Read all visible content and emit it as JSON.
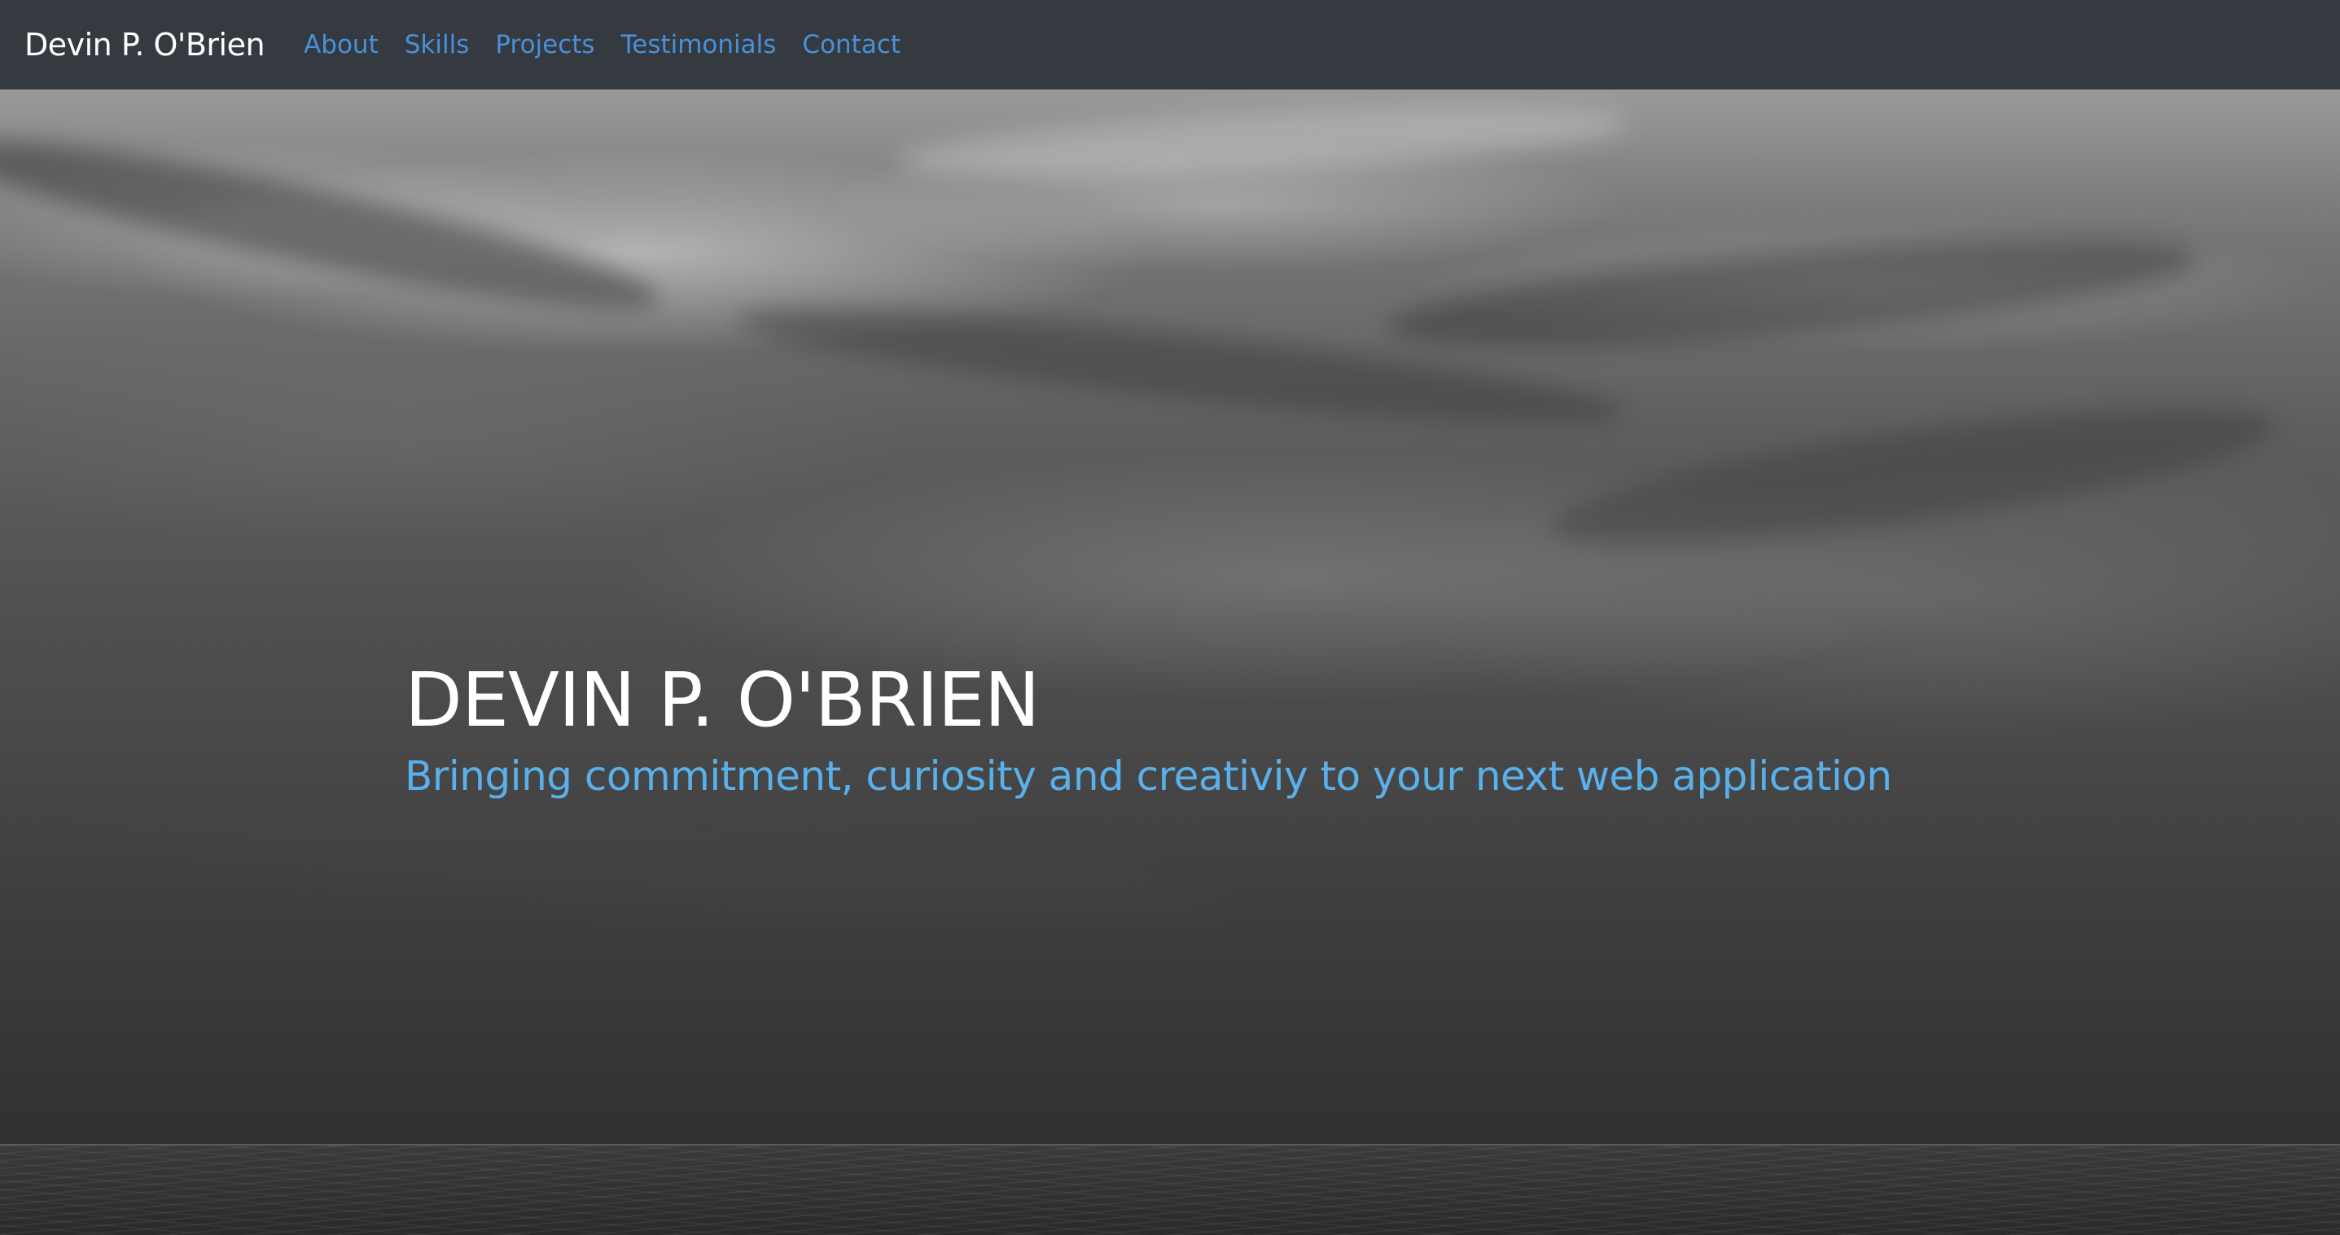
{
  "navbar": {
    "brand": "Devin P. O'Brien",
    "links": [
      {
        "label": "About"
      },
      {
        "label": "Skills"
      },
      {
        "label": "Projects"
      },
      {
        "label": "Testimonials"
      },
      {
        "label": "Contact"
      }
    ]
  },
  "hero": {
    "title": "DEVIN P. O'BRIEN",
    "subtitle": "Bringing commitment, curiosity and creativiy to your next web application"
  },
  "colors": {
    "navbar_bg": "#343a40",
    "brand_text": "#ffffff",
    "nav_link": "#4a90d9",
    "hero_title": "#ffffff",
    "hero_subtitle": "#5ab0ea"
  }
}
